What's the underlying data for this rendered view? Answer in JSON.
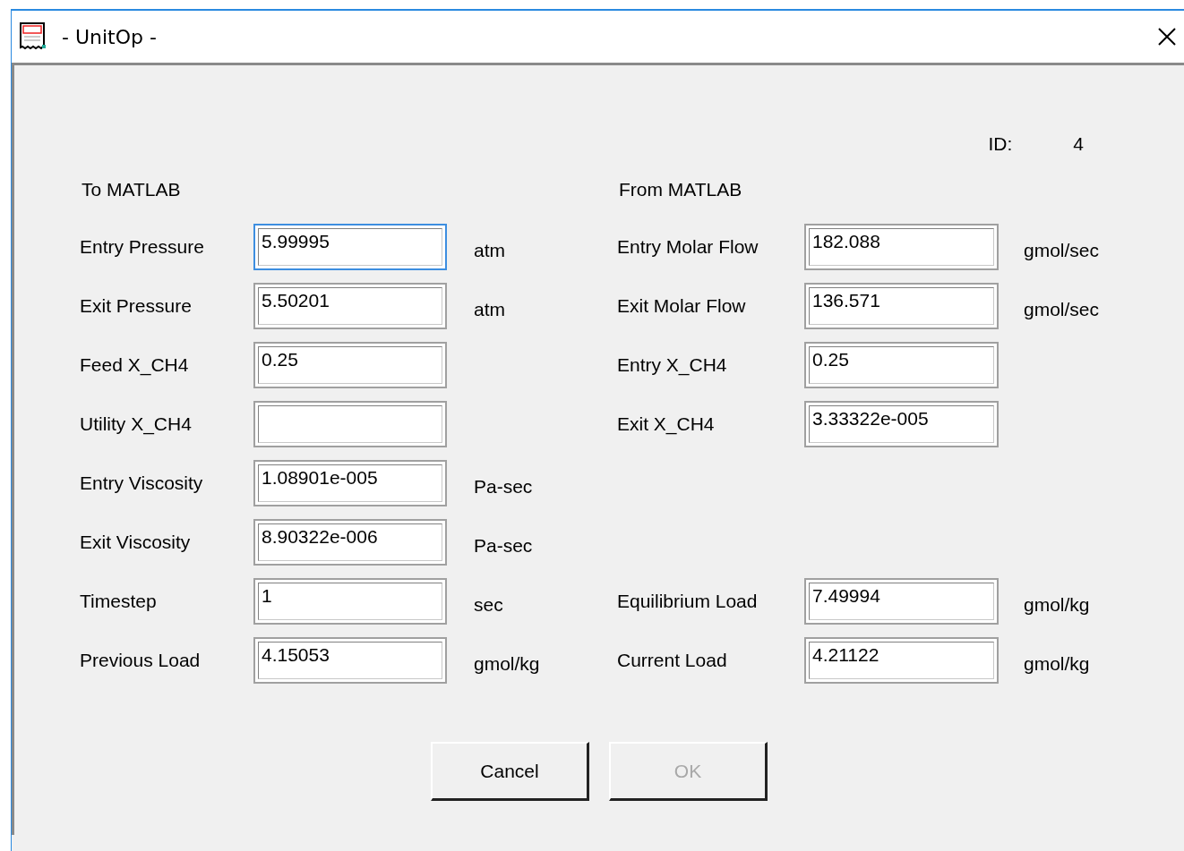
{
  "window": {
    "title": "- UnitOp -"
  },
  "id": {
    "label": "ID:",
    "value": "4"
  },
  "sections": [
    {
      "heading": "To MATLAB"
    },
    {
      "heading": "From MATLAB"
    }
  ],
  "rows": [
    {
      "left": {
        "label": "Entry Pressure",
        "value": "5.99995",
        "unit": "atm",
        "focused": true
      },
      "right": {
        "label": "Entry Molar Flow",
        "value": "182.088",
        "unit": "gmol/sec",
        "focused": false
      }
    },
    {
      "left": {
        "label": "Exit Pressure",
        "value": "5.50201",
        "unit": "atm",
        "focused": false
      },
      "right": {
        "label": "Exit Molar Flow",
        "value": "136.571",
        "unit": "gmol/sec",
        "focused": false
      }
    },
    {
      "left": {
        "label": "Feed X_CH4",
        "value": "0.25",
        "focused": false
      },
      "right": {
        "label": "Entry X_CH4",
        "value": "0.25",
        "focused": false
      }
    },
    {
      "left": {
        "label": "Utility X_CH4",
        "focused": false
      },
      "right": {
        "label": "Exit X_CH4",
        "value": "3.33322e-005",
        "focused": false
      }
    },
    {
      "left": {
        "label": "Entry Viscosity",
        "value": "1.08901e-005",
        "unit": "Pa-sec",
        "focused": false
      }
    },
    {
      "left": {
        "label": "Exit Viscosity",
        "value": "8.90322e-006",
        "unit": "Pa-sec",
        "focused": false
      }
    },
    {
      "left": {
        "label": "Timestep",
        "value": "1",
        "unit": "sec",
        "focused": false
      },
      "right": {
        "label": "Equilibrium Load",
        "value": "7.49994",
        "unit": "gmol/kg",
        "focused": false
      }
    },
    {
      "left": {
        "label": "Previous Load",
        "value": "4.15053",
        "unit": "gmol/kg",
        "focused": false
      },
      "right": {
        "label": "Current Load",
        "value": "4.21122",
        "unit": "gmol/kg",
        "focused": false
      }
    }
  ],
  "buttons": [
    {
      "label": "Cancel",
      "disabled": false
    },
    {
      "label": "OK",
      "disabled": true
    }
  ]
}
